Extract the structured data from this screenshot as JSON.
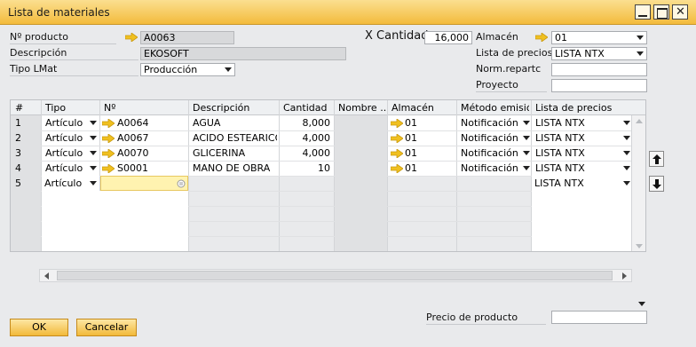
{
  "window": {
    "title": "Lista de materiales"
  },
  "header": {
    "nro_producto_label": "Nº producto",
    "nro_producto_value": "A0063",
    "descripcion_label": "Descripción",
    "descripcion_value": "EKOSOFT",
    "tipo_lmat_label": "Tipo LMat",
    "tipo_lmat_value": "Producción",
    "x_cantidad_label": "X Cantidad",
    "cantidad_value": "16,000",
    "almacen_label": "Almacén",
    "almacen_value": "01",
    "lista_precios_label": "Lista de precios",
    "lista_precios_value": "LISTA NTX",
    "norm_reparto_label": "Norm.repartc",
    "norm_reparto_value": "",
    "proyecto_label": "Proyecto",
    "proyecto_value": ""
  },
  "grid": {
    "columns": [
      "#",
      "Tipo",
      "Nº",
      "Descripción",
      "Cantidad",
      "Nombre ...",
      "Almacén",
      "Método emisión",
      "Lista de precios"
    ],
    "rows": [
      {
        "num": "1",
        "tipo": "Artículo",
        "nro": "A0064",
        "descripcion": "AGUA",
        "cantidad": "8,000",
        "nombre": "",
        "almacen": "01",
        "metodo": "Notificación",
        "lista": "LISTA NTX"
      },
      {
        "num": "2",
        "tipo": "Artículo",
        "nro": "A0067",
        "descripcion": "ACIDO ESTEARICO",
        "cantidad": "4,000",
        "nombre": "",
        "almacen": "01",
        "metodo": "Notificación",
        "lista": "LISTA NTX"
      },
      {
        "num": "3",
        "tipo": "Artículo",
        "nro": "A0070",
        "descripcion": "GLICERINA",
        "cantidad": "4,000",
        "nombre": "",
        "almacen": "01",
        "metodo": "Notificación",
        "lista": "LISTA NTX"
      },
      {
        "num": "4",
        "tipo": "Artículo",
        "nro": "S0001",
        "descripcion": "MANO DE OBRA",
        "cantidad": "10",
        "nombre": "",
        "almacen": "01",
        "metodo": "Notificación",
        "lista": "LISTA NTX"
      },
      {
        "num": "5",
        "tipo": "Artículo",
        "nro": "",
        "descripcion": "",
        "cantidad": "",
        "nombre": "",
        "almacen": "",
        "metodo": "",
        "lista": "LISTA NTX"
      }
    ]
  },
  "footer": {
    "precio_producto_label": "Precio de producto",
    "precio_producto_value": "",
    "ok_label": "OK",
    "cancelar_label": "Cancelar"
  },
  "colors": {
    "accent": "#f3bb3c",
    "link_arrow": "#f0c020",
    "selected_cell": "#fff3b0"
  },
  "icons": [
    "link-arrow-icon",
    "dropdown-arrow-icon",
    "move-up-icon",
    "move-down-icon",
    "minimize-icon",
    "maximize-icon",
    "close-icon",
    "lookup-icon"
  ]
}
